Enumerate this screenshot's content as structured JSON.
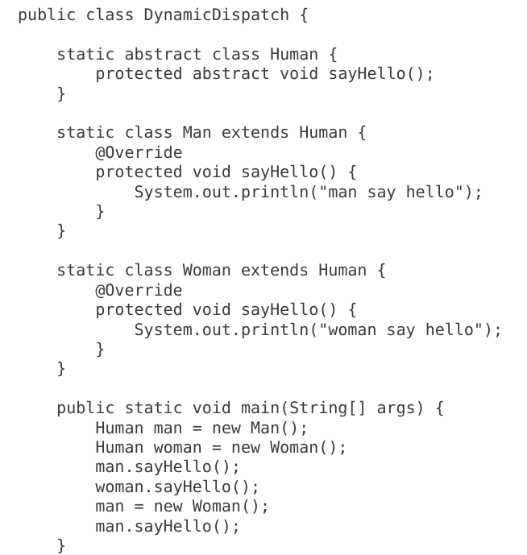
{
  "document": {
    "kind": "source-code-listing",
    "language": "Java",
    "class_name": "DynamicDispatch",
    "background_color": "#ffffff",
    "text_color": "#3a3a3a",
    "font_size_px": 20,
    "line_height_px": 24.4,
    "indent_spaces": 4
  },
  "code": {
    "lines": [
      "public class DynamicDispatch {",
      "",
      "    static abstract class Human {",
      "        protected abstract void sayHello();",
      "    }",
      "",
      "    static class Man extends Human {",
      "        @Override",
      "        protected void sayHello() {",
      "            System.out.println(\"man say hello\");",
      "        }",
      "    }",
      "",
      "    static class Woman extends Human {",
      "        @Override",
      "        protected void sayHello() {",
      "            System.out.println(\"woman say hello\");",
      "        }",
      "    }",
      "",
      "    public static void main(String[] args) {",
      "        Human man = new Man();",
      "        Human woman = new Woman();",
      "        man.sayHello();",
      "        woman.sayHello();",
      "        man = new Woman();",
      "        man.sayHello();",
      "    }"
    ],
    "full_text": "public class DynamicDispatch {\n\n    static abstract class Human {\n        protected abstract void sayHello();\n    }\n\n    static class Man extends Human {\n        @Override\n        protected void sayHello() {\n            System.out.println(\"man say hello\");\n        }\n    }\n\n    static class Woman extends Human {\n        @Override\n        protected void sayHello() {\n            System.out.println(\"woman say hello\");\n        }\n    }\n\n    public static void main(String[] args) {\n        Human man = new Man();\n        Human woman = new Woman();\n        man.sayHello();\n        woman.sayHello();\n        man = new Woman();\n        man.sayHello();\n    }"
  }
}
